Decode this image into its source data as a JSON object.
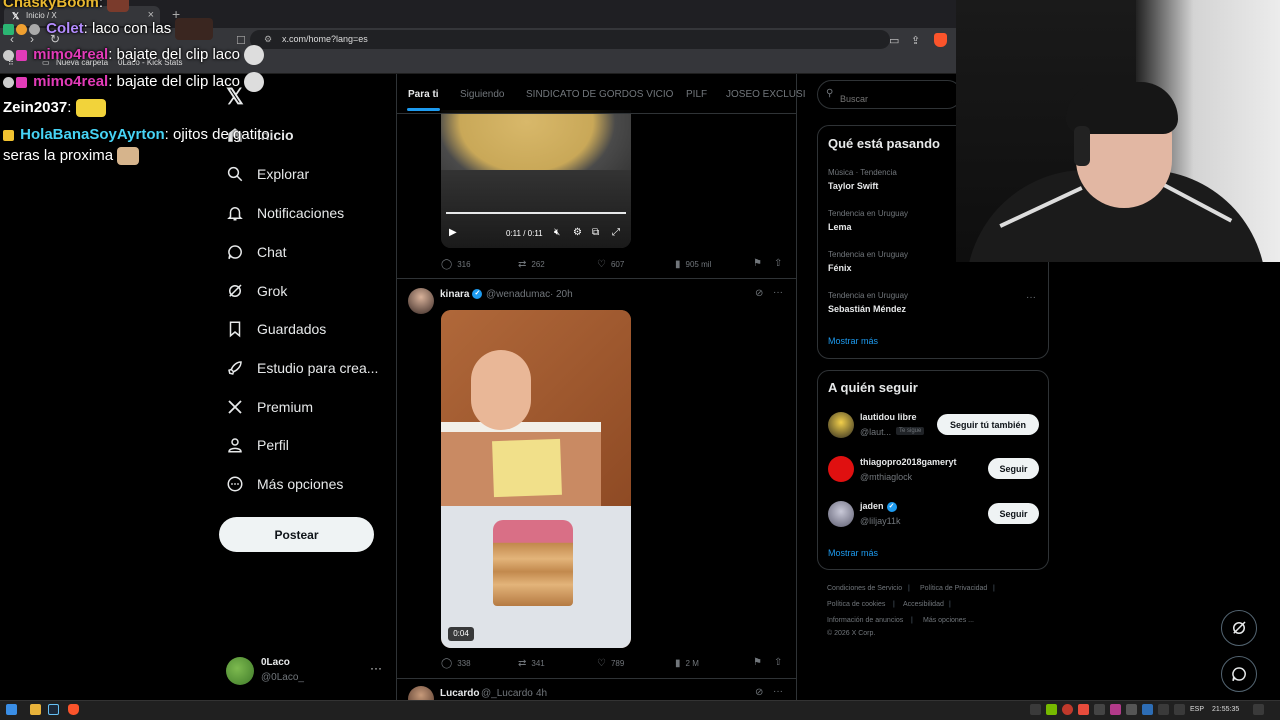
{
  "browser": {
    "tab_title": "Inicio / X",
    "url": "x.com/home?lang=es",
    "bookmarks": [
      "Nueva carpeta",
      "0Laco - Kick Stats"
    ]
  },
  "chat": [
    {
      "user": "ChaskyBoom",
      "text": ":",
      "color": "#e8b830"
    },
    {
      "user": "Colet",
      "text": ": laco con las",
      "color": "#b48cff"
    },
    {
      "user": "mimo4real",
      "text": ": bajate del clip laco",
      "color": "#e23bb8"
    },
    {
      "user": "mimo4real",
      "text": ": bajate del clip laco",
      "color": "#e23bb8"
    },
    {
      "user": "Zein2037",
      "text": ":",
      "color": "#ffffff"
    },
    {
      "user": "HolaBanaSoyAyrton",
      "text": ": ojitos de gatito",
      "color": "#46d3f5"
    },
    {
      "user": "",
      "text": "seras la proxima",
      "color": "#ffffff"
    }
  ],
  "sidebar": {
    "items": [
      {
        "label": "Inicio",
        "icon": "home-icon"
      },
      {
        "label": "Explorar",
        "icon": "search-icon"
      },
      {
        "label": "Notificaciones",
        "icon": "bell-icon"
      },
      {
        "label": "Chat",
        "icon": "chat-icon"
      },
      {
        "label": "Grok",
        "icon": "grok-icon"
      },
      {
        "label": "Guardados",
        "icon": "bookmark-icon"
      },
      {
        "label": "Estudio para crea...",
        "icon": "rocket-icon"
      },
      {
        "label": "Premium",
        "icon": "x-icon"
      },
      {
        "label": "Perfil",
        "icon": "person-icon"
      },
      {
        "label": "Más opciones",
        "icon": "more-circle-icon"
      }
    ],
    "post_label": "Postear",
    "profile": {
      "name": "0Laco",
      "handle": "@0Laco_"
    }
  },
  "feed": {
    "tabs": [
      "Para ti",
      "Siguiendo",
      "SINDICATO DE GORDOS VICIO",
      "PILF",
      "JOSEO EXCLUSI"
    ],
    "video1": {
      "time": "0:11 / 0:11"
    },
    "post1_actions": {
      "replies": "316",
      "reposts": "262",
      "likes": "607",
      "views": "905 mil"
    },
    "post2": {
      "name": "kinara",
      "handle": "@wenadumac",
      "time": "20h",
      "duration": "0:04",
      "actions": {
        "replies": "338",
        "reposts": "341",
        "likes": "789",
        "views": "2 M"
      }
    },
    "post3": {
      "name": "Lucardo",
      "handle": "@_Lucardo",
      "time": "4h"
    }
  },
  "right": {
    "search_placeholder": "Buscar",
    "trending_title": "Qué está pasando",
    "trends": [
      {
        "category": "Música · Tendencia",
        "name": "Taylor Swift"
      },
      {
        "category": "Tendencia en Uruguay",
        "name": "Lema"
      },
      {
        "category": "Tendencia en Uruguay",
        "name": "Fénix"
      },
      {
        "category": "Tendencia en Uruguay",
        "name": "Sebastián Méndez"
      }
    ],
    "show_more": "Mostrar más",
    "follow_title": "A quién seguir",
    "follow": [
      {
        "name": "lautidou libre",
        "handle": "@laut...",
        "badge": "Te sigue",
        "button": "Seguir tú también"
      },
      {
        "name": "thiagopro2018gameryt",
        "handle": "@mthiaglock",
        "button": "Seguir"
      },
      {
        "name": "jaden",
        "handle": "@liljay11k",
        "button": "Seguir"
      }
    ],
    "footer": [
      "Condiciones de Servicio",
      "Política de Privacidad",
      "Política de cookies",
      "Accesibilidad",
      "Información de anuncios",
      "Más opciones ...",
      "© 2026 X Corp."
    ]
  },
  "taskbar": {
    "lang": "ESP",
    "time": "21:55:35"
  }
}
